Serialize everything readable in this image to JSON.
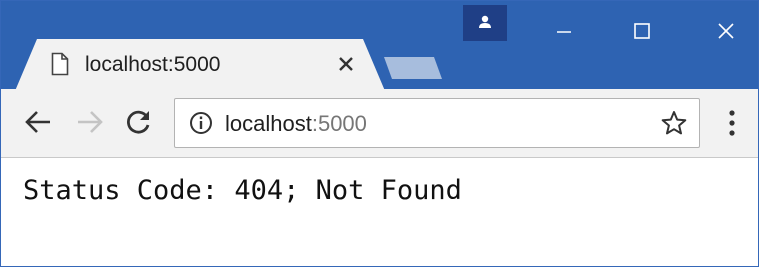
{
  "browser": {
    "tab": {
      "title": "localhost:5000",
      "icon": "document-icon"
    },
    "address_bar": {
      "host": "localhost",
      "port": ":5000",
      "icon": "info-icon"
    },
    "window_controls": [
      "minimize-icon",
      "maximize-icon",
      "close-icon"
    ],
    "colors": {
      "title_bar": "#2e63b2",
      "toolbar": "#f2f2f2"
    }
  },
  "page": {
    "body_text": "Status Code: 404; Not Found"
  }
}
